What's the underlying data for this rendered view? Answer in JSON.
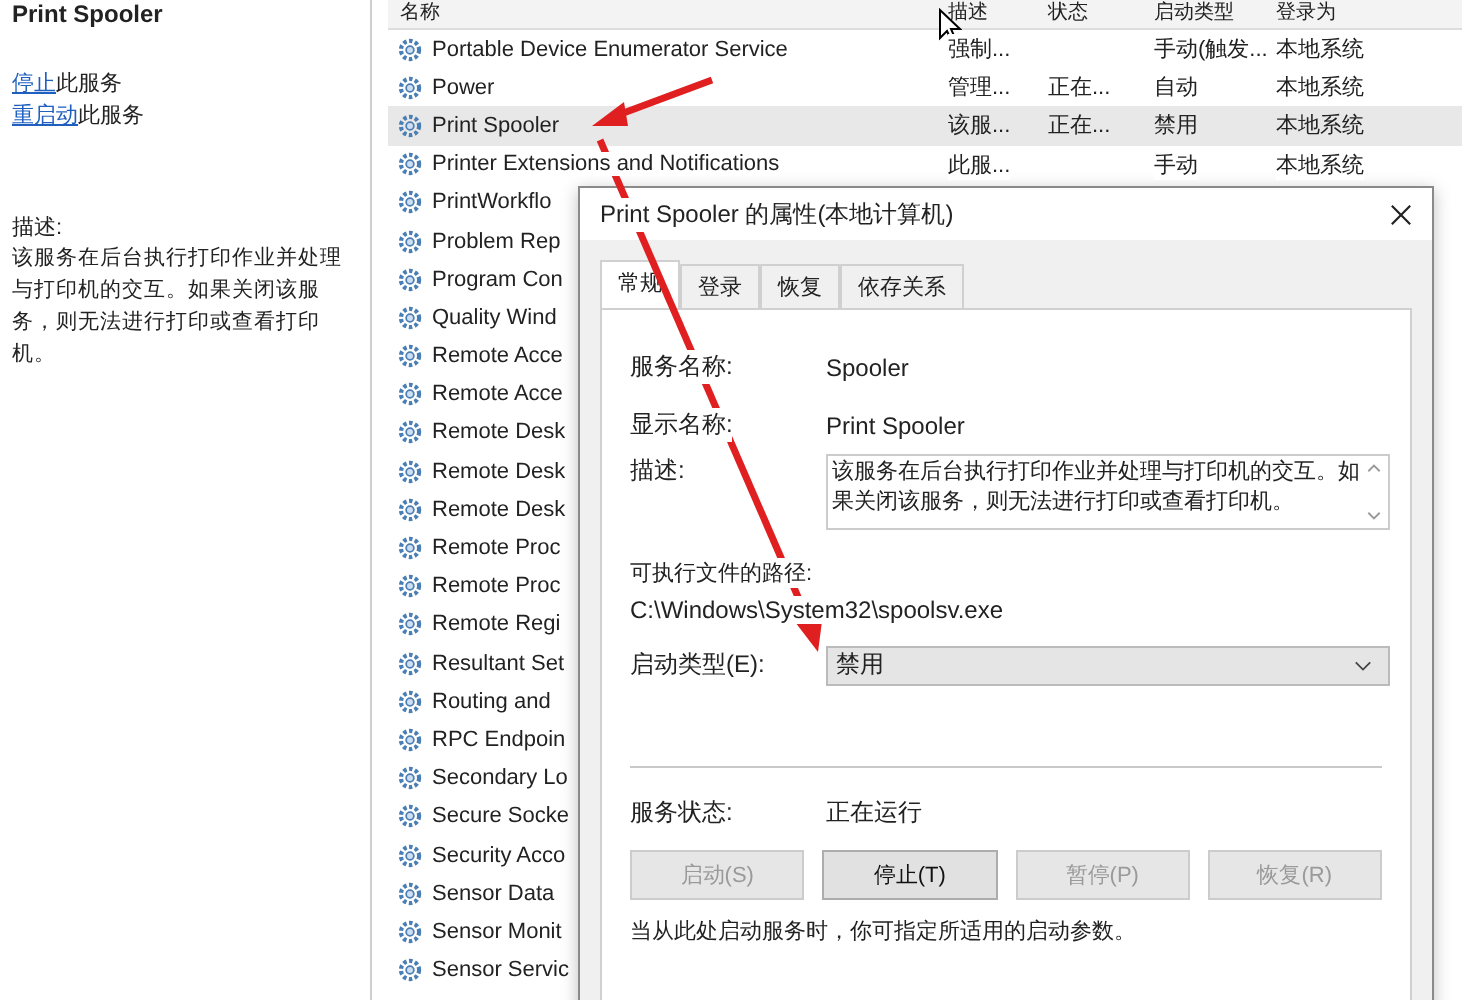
{
  "left_pane": {
    "title": "Print Spooler",
    "actions": [
      {
        "link": "停止",
        "text": "此服务"
      },
      {
        "link": "重启动",
        "text": "此服务"
      }
    ],
    "description_label": "描述:",
    "description": "该服务在后台执行打印作业并处理与打印机的交互。如果关闭该服务，则无法进行打印或查看打印机。"
  },
  "services": {
    "columns": [
      "名称",
      "描述",
      "状态",
      "启动类型",
      "登录为"
    ],
    "rows": [
      {
        "name": "Portable Device Enumerator Service",
        "description": "强制...",
        "status": "",
        "startup": "手动(触发...",
        "logon": "本地系统",
        "selected": false
      },
      {
        "name": "Power",
        "description": "管理...",
        "status": "正在...",
        "startup": "自动",
        "logon": "本地系统",
        "selected": false
      },
      {
        "name": "Print Spooler",
        "description": "该服...",
        "status": "正在...",
        "startup": "禁用",
        "logon": "本地系统",
        "selected": true
      },
      {
        "name": "Printer Extensions and Notifications",
        "description": "此服...",
        "status": "",
        "startup": "手动",
        "logon": "本地系统",
        "selected": false
      },
      {
        "name": "PrintWorkflo",
        "selected": false
      },
      {
        "name": "Problem Rep",
        "selected": false
      },
      {
        "name": "Program Con",
        "selected": false
      },
      {
        "name": "Quality Wind",
        "selected": false
      },
      {
        "name": "Remote Acce",
        "selected": false
      },
      {
        "name": "Remote Acce",
        "selected": false
      },
      {
        "name": "Remote Desk",
        "selected": false
      },
      {
        "name": "Remote Desk",
        "selected": false
      },
      {
        "name": "Remote Desk",
        "selected": false
      },
      {
        "name": "Remote Proc",
        "selected": false
      },
      {
        "name": "Remote Proc",
        "selected": false
      },
      {
        "name": "Remote Regi",
        "selected": false
      },
      {
        "name": "Resultant Set",
        "selected": false
      },
      {
        "name": "Routing and",
        "selected": false
      },
      {
        "name": "RPC Endpoin",
        "selected": false
      },
      {
        "name": "Secondary Lo",
        "selected": false
      },
      {
        "name": "Secure Socke",
        "selected": false
      },
      {
        "name": "Security Acco",
        "selected": false
      },
      {
        "name": "Sensor Data",
        "selected": false
      },
      {
        "name": "Sensor Monit",
        "selected": false
      },
      {
        "name": "Sensor Servic",
        "selected": false
      }
    ]
  },
  "dialog": {
    "title": "Print Spooler 的属性(本地计算机)",
    "tabs": [
      {
        "label": "常规",
        "selected": true
      },
      {
        "label": "登录",
        "selected": false
      },
      {
        "label": "恢复",
        "selected": false
      },
      {
        "label": "依存关系",
        "selected": false
      }
    ],
    "service_name_label": "服务名称:",
    "service_name": "Spooler",
    "display_name_label": "显示名称:",
    "display_name": "Print Spooler",
    "description_label": "描述:",
    "description": "该服务在后台执行打印作业并处理与打印机的交互。如果关闭该服务，则无法进行打印或查看打印机。",
    "path_label": "可执行文件的路径:",
    "path": "C:\\Windows\\System32\\spoolsv.exe",
    "startup_label": "启动类型(E):",
    "startup_value": "禁用",
    "status_label": "服务状态:",
    "status_value": "正在运行",
    "buttons": [
      {
        "label": "启动(S)",
        "disabled": true
      },
      {
        "label": "停止(T)",
        "disabled": false
      },
      {
        "label": "暂停(P)",
        "disabled": true
      },
      {
        "label": "恢复(R)",
        "disabled": true
      }
    ],
    "hint": "当从此处启动服务时，你可指定所适用的启动参数。"
  }
}
